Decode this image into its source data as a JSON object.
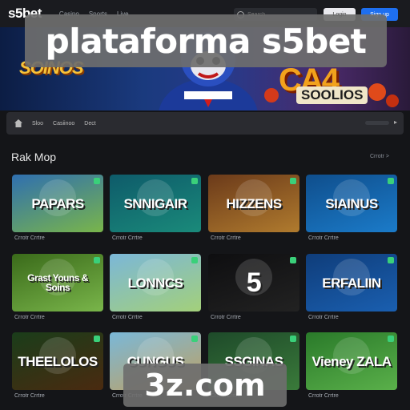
{
  "nav": {
    "logo": "s5bet",
    "links": [
      "Casino",
      "Sports",
      "Live"
    ],
    "search_placeholder": "Search",
    "login_label": "Login",
    "signup_label": "Sign up"
  },
  "hero": {
    "left_text": "SOINOS",
    "right_text": "CA4",
    "sub_text": "SOOLIOS"
  },
  "overlay": {
    "title": "plataforma s5bet",
    "domain": "3z.com"
  },
  "categories": [
    "Sloo",
    "Casiinoo",
    "Dect"
  ],
  "section": {
    "title": "Rak Mop",
    "link": "Crrotr >"
  },
  "games": [
    {
      "title": "PAPARS",
      "caption": "Crrotr Crrtre",
      "bg": "#2f6fb0",
      "bg2": "#79b54a"
    },
    {
      "title": "SNNIGAIR",
      "caption": "Crrotr Crrtre",
      "bg": "#0e5b6a",
      "bg2": "#1a8a7a"
    },
    {
      "title": "HIZZENS",
      "caption": "Crrotr Crrtre",
      "bg": "#6b3a1a",
      "bg2": "#b07b2e"
    },
    {
      "title": "SIAINUS",
      "caption": "Crrotr Crrtre",
      "bg": "#0f4e8c",
      "bg2": "#1b7bc9"
    },
    {
      "title": "Grast Youns & Soins",
      "caption": "Crrotr Crrtre",
      "bg": "#3a6a1a",
      "bg2": "#79b54a"
    },
    {
      "title": "LONNCS",
      "caption": "Crrotr Crrtre",
      "bg": "#7bb7d8",
      "bg2": "#a3d07a"
    },
    {
      "title": "5",
      "caption": "Crrotr Crrtre",
      "bg": "#0e0e10",
      "bg2": "#222"
    },
    {
      "title": "ERFALIIN",
      "caption": "Crrotr Crrtre",
      "bg": "#0f3d7a",
      "bg2": "#1a5fb0"
    },
    {
      "title": "THEELOLOS",
      "caption": "Crrotr Crrtre",
      "bg": "#1a3d1a",
      "bg2": "#4a2a10"
    },
    {
      "title": "CUNGUS",
      "caption": "Crrotr Crrtre",
      "bg": "#7ab8d8",
      "bg2": "#c0a060"
    },
    {
      "title": "SSGINAS",
      "caption": "Crrotr Crrtre",
      "bg": "#1e4a2a",
      "bg2": "#3a7a3a"
    },
    {
      "title": "Vieney ZALA",
      "caption": "Crrotr Crrtre",
      "bg": "#2a7a2a",
      "bg2": "#5ab04a"
    }
  ],
  "colors": {
    "accent": "#1e6ff0",
    "badge": "#3ad07a"
  }
}
